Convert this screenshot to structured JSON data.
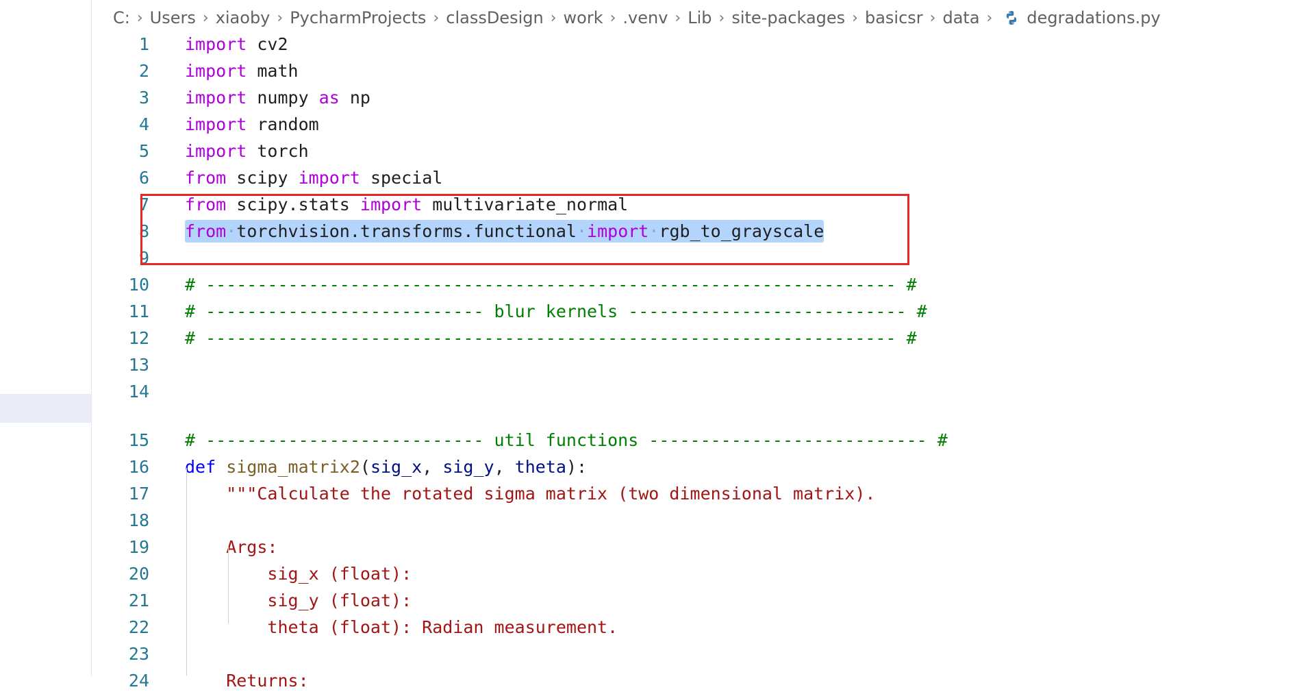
{
  "breadcrumb": [
    "C:",
    "Users",
    "xiaoby",
    "PycharmProjects",
    "classDesign",
    "work",
    ".venv",
    "Lib",
    "site-packages",
    "basicsr",
    "data"
  ],
  "file_name": "degradations.py",
  "file_icon": "python-icon",
  "lines": [
    {
      "n": "1",
      "tokens": [
        {
          "c": "kw",
          "t": "import"
        },
        {
          "c": "plain",
          "t": " cv2"
        }
      ]
    },
    {
      "n": "2",
      "tokens": [
        {
          "c": "kw",
          "t": "import"
        },
        {
          "c": "plain",
          "t": " math"
        }
      ]
    },
    {
      "n": "3",
      "tokens": [
        {
          "c": "kw",
          "t": "import"
        },
        {
          "c": "plain",
          "t": " numpy "
        },
        {
          "c": "kw",
          "t": "as"
        },
        {
          "c": "plain",
          "t": " np"
        }
      ]
    },
    {
      "n": "4",
      "tokens": [
        {
          "c": "kw",
          "t": "import"
        },
        {
          "c": "plain",
          "t": " random"
        }
      ]
    },
    {
      "n": "5",
      "tokens": [
        {
          "c": "kw",
          "t": "import"
        },
        {
          "c": "plain",
          "t": " torch"
        }
      ]
    },
    {
      "n": "6",
      "tokens": [
        {
          "c": "kw",
          "t": "from"
        },
        {
          "c": "plain",
          "t": " scipy "
        },
        {
          "c": "kw",
          "t": "import"
        },
        {
          "c": "plain",
          "t": " special"
        }
      ]
    },
    {
      "n": "7",
      "tokens": [
        {
          "c": "kw",
          "t": "from"
        },
        {
          "c": "plain",
          "t": " scipy.stats "
        },
        {
          "c": "kw",
          "t": "import"
        },
        {
          "c": "plain",
          "t": " multivariate_normal"
        }
      ]
    },
    {
      "n": "8",
      "highlight": true,
      "tokens": [
        {
          "c": "kw",
          "t": "from"
        },
        {
          "c": "dot",
          "t": "·"
        },
        {
          "c": "plain",
          "t": "torchvision.transforms.functional"
        },
        {
          "c": "dot",
          "t": "·"
        },
        {
          "c": "kw",
          "t": "import"
        },
        {
          "c": "dot",
          "t": "·"
        },
        {
          "c": "plain",
          "t": "rgb_to_grayscale"
        }
      ]
    },
    {
      "n": "9",
      "tokens": []
    },
    {
      "n": "10",
      "tokens": [
        {
          "c": "cm",
          "t": "# ------------------------------------------------------------------- #"
        }
      ]
    },
    {
      "n": "11",
      "tokens": [
        {
          "c": "cm",
          "t": "# --------------------------- blur kernels --------------------------- #"
        }
      ]
    },
    {
      "n": "12",
      "tokens": [
        {
          "c": "cm",
          "t": "# ------------------------------------------------------------------- #"
        }
      ]
    },
    {
      "n": "13",
      "tokens": []
    },
    {
      "n": "14",
      "tokens": []
    },
    {
      "n": "15",
      "tokens": [
        {
          "c": "cm",
          "t": "# --------------------------- util functions --------------------------- #"
        }
      ]
    },
    {
      "n": "16",
      "tokens": [
        {
          "c": "kw2",
          "t": "def"
        },
        {
          "c": "plain",
          "t": " "
        },
        {
          "c": "fn",
          "t": "sigma_matrix2"
        },
        {
          "c": "plain",
          "t": "("
        },
        {
          "c": "param",
          "t": "sig_x"
        },
        {
          "c": "plain",
          "t": ", "
        },
        {
          "c": "param",
          "t": "sig_y"
        },
        {
          "c": "plain",
          "t": ", "
        },
        {
          "c": "param",
          "t": "theta"
        },
        {
          "c": "plain",
          "t": "):"
        }
      ]
    },
    {
      "n": "17",
      "tokens": [
        {
          "c": "str",
          "t": "    \"\"\"Calculate the rotated sigma matrix (two dimensional matrix)."
        }
      ]
    },
    {
      "n": "18",
      "tokens": []
    },
    {
      "n": "19",
      "tokens": [
        {
          "c": "str",
          "t": "    Args:"
        }
      ]
    },
    {
      "n": "20",
      "tokens": [
        {
          "c": "str",
          "t": "        sig_x (float):"
        }
      ]
    },
    {
      "n": "21",
      "tokens": [
        {
          "c": "str",
          "t": "        sig_y (float):"
        }
      ]
    },
    {
      "n": "22",
      "tokens": [
        {
          "c": "str",
          "t": "        theta (float): Radian measurement."
        }
      ]
    },
    {
      "n": "23",
      "tokens": []
    },
    {
      "n": "24",
      "tokens": [
        {
          "c": "str",
          "t": "    Returns:"
        }
      ]
    }
  ],
  "colors": {
    "keyword": "#af00db",
    "comment": "#008000",
    "string": "#a31515",
    "line_number": "#237893",
    "selection": "#b3d4fc",
    "annotation": "#e8262a"
  }
}
